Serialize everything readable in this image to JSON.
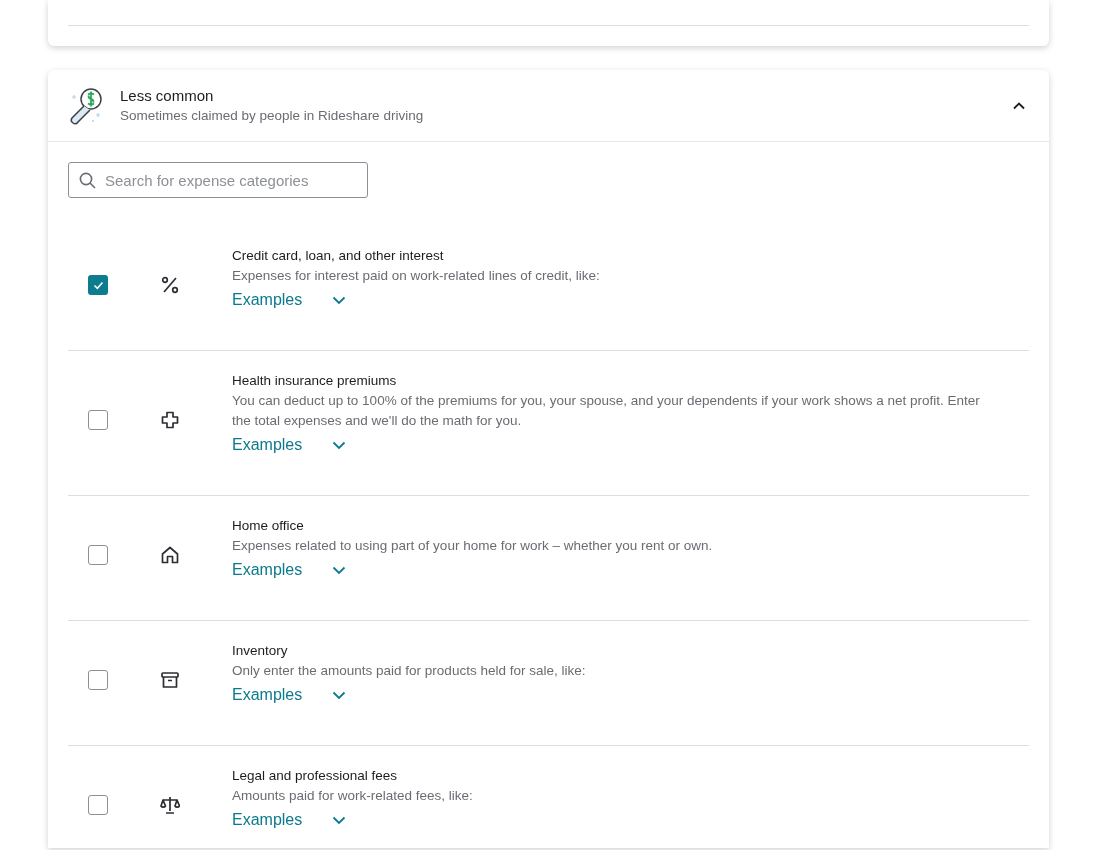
{
  "section": {
    "title": "Less common",
    "subtitle": "Sometimes claimed by people in Rideshare driving",
    "expanded": true
  },
  "search": {
    "placeholder": "Search for expense categories"
  },
  "categories": [
    {
      "title": "Credit card, loan, and other interest",
      "description": "Expenses for interest paid on work-related lines of credit, like:",
      "examples": "Examples",
      "checked": true
    },
    {
      "title": "Health insurance premiums",
      "description": "You can deduct up to 100% of the premiums for you, your spouse, and your dependents if your work shows a net profit. Enter the total expenses and we'll do the math for you.",
      "examples": "Examples",
      "checked": false
    },
    {
      "title": "Home office",
      "description": "Expenses related to using part of your home for work – whether you rent or own.",
      "examples": "Examples",
      "checked": false
    },
    {
      "title": "Inventory",
      "description": "Only enter the amounts paid for products held for sale, like:",
      "examples": "Examples",
      "checked": false
    },
    {
      "title": "Legal and professional fees",
      "description": "Amounts paid for work-related fees, like:",
      "examples": "Examples",
      "checked": false
    }
  ]
}
